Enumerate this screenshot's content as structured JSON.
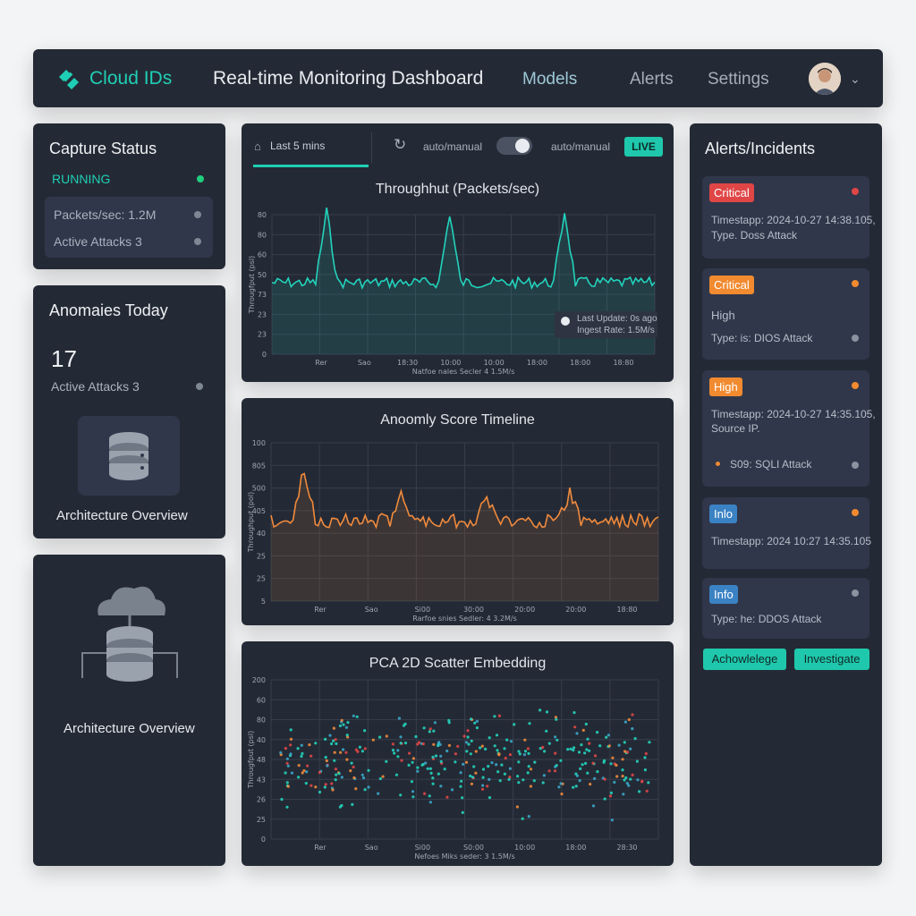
{
  "header": {
    "brand": "Cloud IDs",
    "title": "Real-time Monitoring Dashboard",
    "nav": [
      "Models",
      "Alerts",
      "Settings"
    ]
  },
  "capture": {
    "title": "Capture Status",
    "status": "RUNNING",
    "packets": "Packets/sec: 1.2M",
    "attacks": "Active Attacks 3"
  },
  "anomalies": {
    "title": "Anomaies Today",
    "count": "17",
    "attacks": "Active Attacks 3",
    "caption": "Architecture Overview"
  },
  "architecture": {
    "caption": "Architecture Overview"
  },
  "toolbar": {
    "range": "Last 5 mins",
    "mode_left": "auto/manual",
    "mode_right": "auto/manual",
    "live": "LIVE"
  },
  "throughput": {
    "title": "Throughhut (Packets/sec)",
    "ylabel": "Througfput (psl)",
    "yticks": [
      "0",
      "23",
      "23",
      "73",
      "50",
      "60",
      "80",
      "80"
    ],
    "xticks": [
      "Rer",
      "Sao",
      "18:30",
      "10:00",
      "10:00",
      "18:00",
      "18:00",
      "18:80"
    ],
    "caption": "Natfoe nales Secler 4 1.5M/s",
    "last_update": "Last Update: 0s ago",
    "ingest": "Ingest Rate: 1.5M/s"
  },
  "anomaly_chart": {
    "title": "Anoomly Score Timeline",
    "ylabel": "Throughput (pol)",
    "yticks": [
      "5",
      "25",
      "25",
      "40",
      "405",
      "500",
      "805",
      "100"
    ],
    "xticks": [
      "Rer",
      "Sao",
      "Si00",
      "30:00",
      "20:00",
      "20:00",
      "18:80"
    ],
    "caption": "Rarfoe snies Sedler: 4 3.2M/s"
  },
  "pca": {
    "title": "PCA 2D Scatter Embedding",
    "ylabel": "Througfput (psl)",
    "yticks": [
      "0",
      "25",
      "26",
      "43",
      "48",
      "40",
      "80",
      "60",
      "200"
    ],
    "xticks": [
      "Rer",
      "Sao",
      "Si00",
      "S0:00",
      "10:00",
      "18:00",
      "28:30"
    ],
    "caption": "Nefoes Miks seder: 3 1.5M/s"
  },
  "alerts": {
    "title": "Alerts/Incidents",
    "items": [
      {
        "badge": "Critical",
        "badge_color": "#e04646",
        "dot_color": "#e04646",
        "line1": "Timestapp: 2024-10-27 14:38.105,",
        "line2": "Type. Doss Attack"
      },
      {
        "badge": "Critical",
        "badge_color": "#f28a30",
        "dot_color": "#f28a30",
        "line1": "High",
        "line2": "Type: is: DIOS Attack"
      },
      {
        "badge": "High",
        "badge_color": "#f28a30",
        "dot_color": "#f28a30",
        "line1": "Timestapp: 2024-10-27 14:35.105,",
        "line2": "Source IP.",
        "line3": "S09: SQLI Attack"
      },
      {
        "badge": "Inlo",
        "badge_color": "#3b82c4",
        "dot_color": "#f28a30",
        "line1": "Timestapp: 2024 10:27 14:35.105"
      },
      {
        "badge": "Info",
        "badge_color": "#3b82c4",
        "dot_color": "#8a93a0",
        "line1": "Type: he: DDOS Attack"
      }
    ],
    "acknowledge": "Achowlelege",
    "investigate": "Investigate"
  },
  "colors": {
    "accent": "#1fcfb5",
    "critical": "#e04646",
    "warning": "#f28a30",
    "info": "#3b82c4",
    "panel": "#242a35"
  }
}
